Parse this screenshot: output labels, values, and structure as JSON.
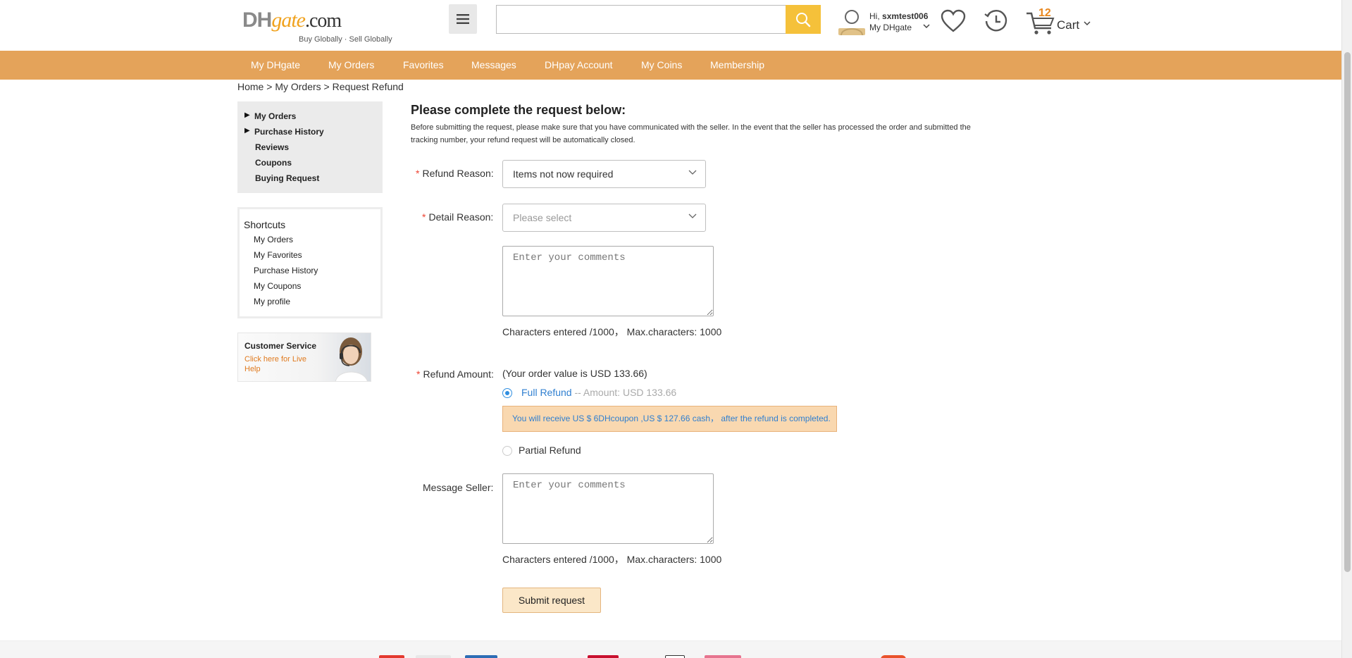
{
  "header": {
    "logo": {
      "dh": "DH",
      "gate": "gate",
      "com": ".com",
      "tagline": "Buy Globally · Sell Globally"
    },
    "search": {
      "value": "",
      "placeholder": ""
    },
    "user": {
      "greeting": "Hi,",
      "username": "sxmtest006",
      "my_dhgate": "My DHgate"
    },
    "cart": {
      "count": "12",
      "label": "Cart"
    }
  },
  "nav": {
    "items": [
      "My DHgate",
      "My Orders",
      "Favorites",
      "Messages",
      "DHpay Account",
      "My Coins",
      "Membership"
    ]
  },
  "breadcrumb": {
    "home": "Home",
    "sep1": " > ",
    "orders": "My Orders",
    "sep2": " > ",
    "current": "Request Refund"
  },
  "left_menu": {
    "items": [
      "My Orders",
      "Purchase History",
      "Reviews",
      "Coupons",
      "Buying Request"
    ]
  },
  "shortcuts": {
    "title": "Shortcuts",
    "items": [
      "My Orders",
      "My Favorites",
      "Purchase History",
      "My Coupons",
      "My profile"
    ]
  },
  "customer_service": {
    "title": "Customer Service",
    "subtitle": "Click here for Live Help"
  },
  "form": {
    "title": "Please complete the request below:",
    "description": "Before submitting the request, please make sure that you have communicated with the seller. In the event that the seller has processed the order and submitted the tracking number, your refund request will be automatically closed.",
    "required_mark": "*",
    "refund_reason": {
      "label": "Refund Reason:",
      "value": "Items not now required"
    },
    "detail_reason": {
      "label": "Detail Reason:",
      "placeholder": "Please select"
    },
    "comments": {
      "placeholder": "Enter your comments",
      "value": ""
    },
    "char_count_text": "Characters entered /1000， Max.characters: 1000",
    "refund_amount": {
      "label": "Refund Amount:",
      "order_value": "(Your order value is USD 133.66)",
      "full_refund_label": "Full Refund",
      "full_refund_amount": " -- Amount: USD 133.66",
      "full_refund_selected": true,
      "note": "You will receive US $ 6DHcoupon ,US $ 127.66 cash， after the refund is completed.",
      "partial_refund_label": "Partial Refund"
    },
    "message_seller": {
      "label": "Message Seller:",
      "placeholder": "Enter your comments",
      "value": ""
    },
    "submit_label": "Submit request"
  },
  "colors": {
    "nav_bg": "#e4a35a",
    "search_btn": "#f5c13a",
    "link_blue": "#2f7fd0",
    "cart_count": "#e8871e",
    "note_bg": "#f9d8b0"
  },
  "icons": {
    "menu": "hamburger-icon",
    "search": "magnifier-icon",
    "user": "user-avatar-icon",
    "wishlist": "heart-icon",
    "history": "clock-history-icon",
    "cart": "cart-icon",
    "caret": "chevron-down-icon",
    "left_arrow": "triangle-right-icon"
  }
}
